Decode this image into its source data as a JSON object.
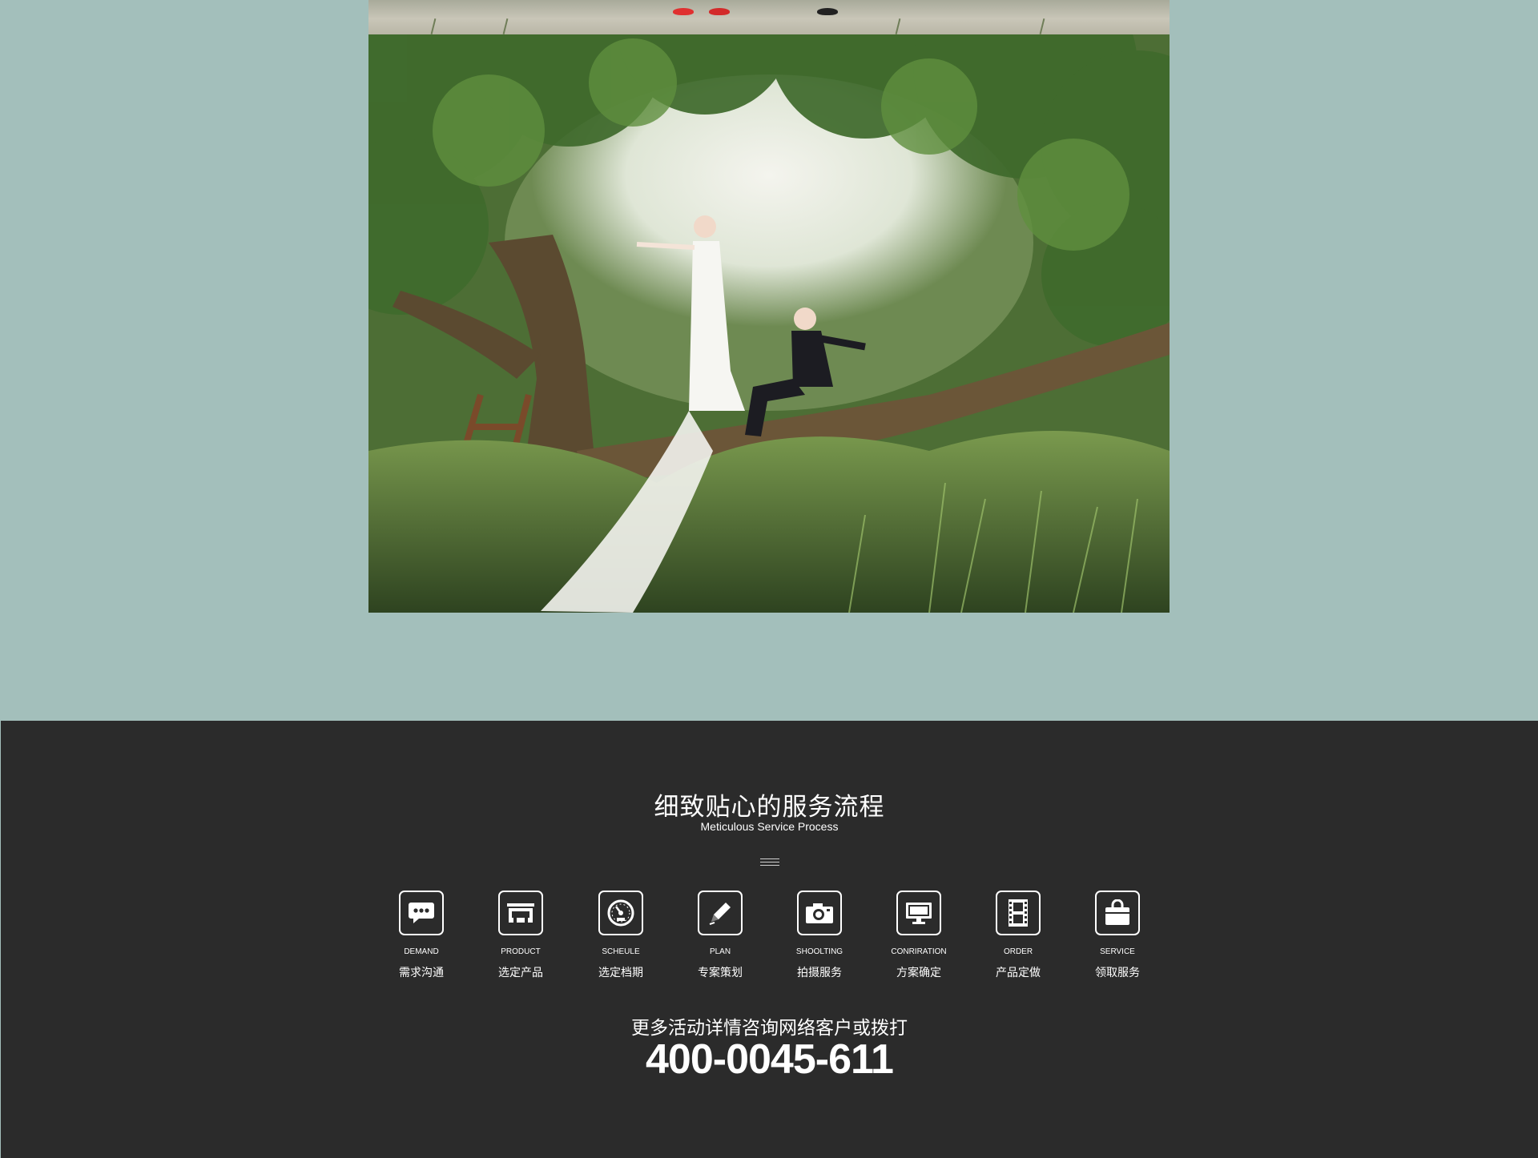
{
  "service": {
    "title": "细致贴心的服务流程",
    "subtitle": "Meticulous Service Process",
    "steps": [
      {
        "en": "DEMAND",
        "cn": "需求沟通",
        "icon": "speech-bubble-icon"
      },
      {
        "en": "PRODUCT",
        "cn": "选定产品",
        "icon": "product-stack-icon"
      },
      {
        "en": "SCHEULE",
        "cn": "选定档期",
        "icon": "speedometer-icon"
      },
      {
        "en": "PLAN",
        "cn": "专案策划",
        "icon": "pencil-icon"
      },
      {
        "en": "SHOOLTING",
        "cn": "拍摄服务",
        "icon": "camera-icon"
      },
      {
        "en": "CONRIRATION",
        "cn": "方案确定",
        "icon": "monitor-icon"
      },
      {
        "en": "ORDER",
        "cn": "产品定做",
        "icon": "film-strip-icon"
      },
      {
        "en": "SERVICE",
        "cn": "领取服务",
        "icon": "shopping-bag-icon"
      }
    ]
  },
  "contact": {
    "line": "更多活动详情咨询网络客户或拨打",
    "phone": "400-0045-611"
  },
  "colors": {
    "page_background": "#a3bfbb",
    "section_background": "#2b2b2b",
    "text": "#ffffff"
  }
}
